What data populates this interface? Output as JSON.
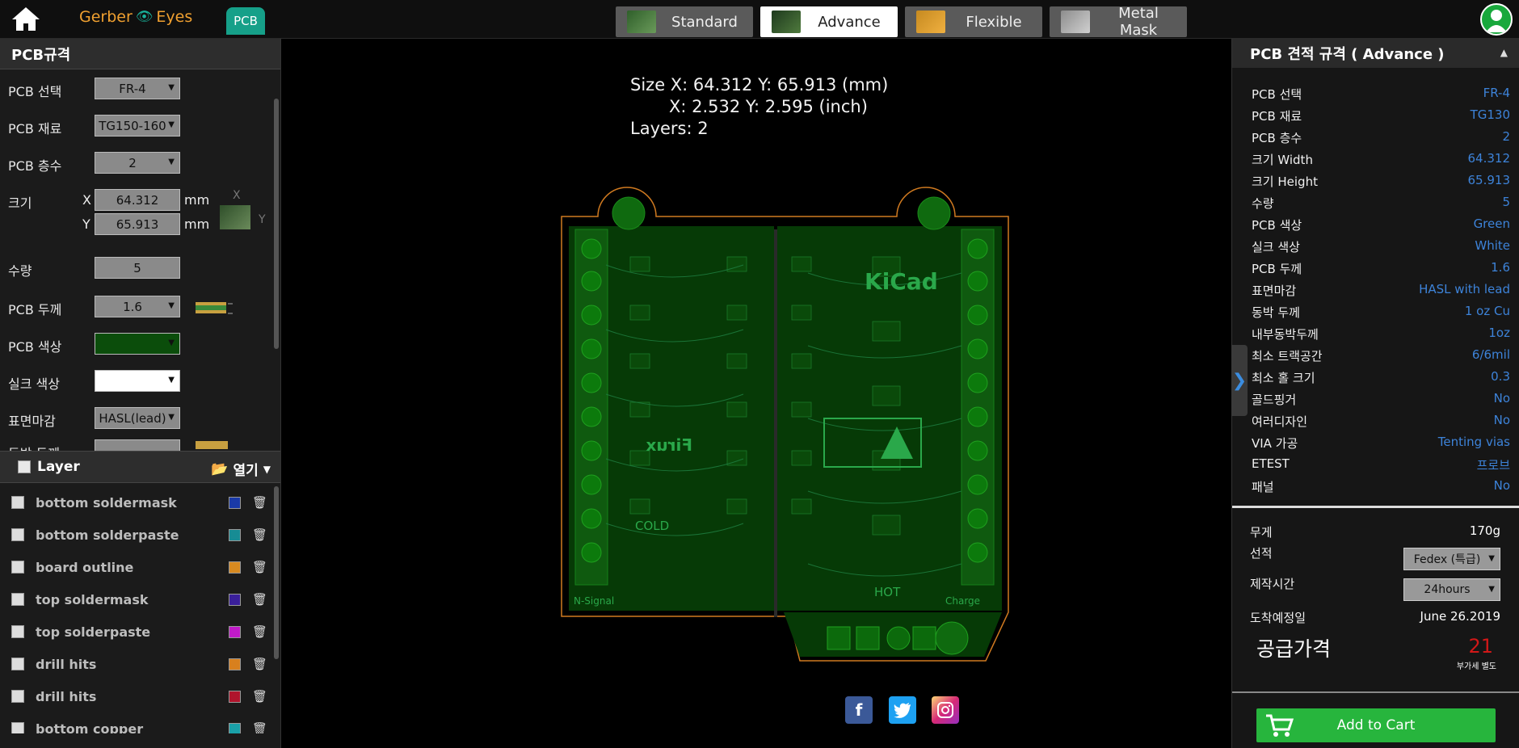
{
  "brand": {
    "gerber": "Gerber",
    "eyes": "Eyes",
    "chip": "PCB"
  },
  "tabs": [
    {
      "label": "Standard",
      "active": false
    },
    {
      "label": "Advance",
      "active": true
    },
    {
      "label": "Flexible",
      "active": false
    },
    {
      "label": "Metal Mask",
      "active": false
    }
  ],
  "left": {
    "title": "PCB규격",
    "pcb_select": {
      "label": "PCB 선택",
      "value": "FR-4"
    },
    "pcb_material": {
      "label": "PCB 재료",
      "value": "TG150-160"
    },
    "pcb_layers": {
      "label": "PCB 층수",
      "value": "2"
    },
    "size": {
      "label": "크기",
      "x_label": "X",
      "y_label": "Y",
      "x": "64.312",
      "y": "65.913",
      "unit": "mm",
      "x_hint": "X",
      "y_hint": "Y"
    },
    "quantity": {
      "label": "수량",
      "value": "5"
    },
    "thickness": {
      "label": "PCB 두께",
      "value": "1.6"
    },
    "pcb_color": {
      "label": "PCB 색상",
      "swatch": "#0b4d0b"
    },
    "silk_color": {
      "label": "실크 색상",
      "swatch": "#ffffff"
    },
    "surface": {
      "label": "표면마감",
      "value": "HASL(lead)"
    },
    "copper": {
      "label": "동박 두께"
    }
  },
  "layers": {
    "title": "Layer",
    "open_label": "열기",
    "items": [
      {
        "name": "bottom soldermask",
        "color": "#1a3aa8"
      },
      {
        "name": "bottom solderpaste",
        "color": "#178c94"
      },
      {
        "name": "board outline",
        "color": "#d88a20"
      },
      {
        "name": "top soldermask",
        "color": "#3a1f9a"
      },
      {
        "name": "top solderpaste",
        "color": "#c01ac8"
      },
      {
        "name": "drill hits",
        "color": "#d8801e"
      },
      {
        "name": "drill hits",
        "color": "#b0142c"
      },
      {
        "name": "bottom copper",
        "color": "#1aa0a8"
      }
    ]
  },
  "center": {
    "size_line1": "Size X: 64.312 Y: 65.913 (mm)",
    "size_line2": "X: 2.532 Y: 2.595 (inch)",
    "layers_line": "Layers: 2"
  },
  "right": {
    "title": "PCB 견적 규격 ( Advance )",
    "specs": [
      {
        "k": "PCB 선택",
        "v": "FR-4"
      },
      {
        "k": "PCB 재료",
        "v": "TG130"
      },
      {
        "k": "PCB 층수",
        "v": "2"
      },
      {
        "k": "크기 Width",
        "v": "64.312"
      },
      {
        "k": "크기 Height",
        "v": "65.913"
      },
      {
        "k": "수량",
        "v": "5"
      },
      {
        "k": "PCB 색상",
        "v": "Green"
      },
      {
        "k": "실크 색상",
        "v": "White"
      },
      {
        "k": "PCB 두께",
        "v": "1.6"
      },
      {
        "k": "표면마감",
        "v": "HASL with lead"
      },
      {
        "k": "동박 두께",
        "v": "1 oz Cu"
      },
      {
        "k": "내부동박두께",
        "v": "1oz"
      },
      {
        "k": "최소 트랙공간",
        "v": "6/6mil"
      },
      {
        "k": "최소 홀 크기",
        "v": "0.3"
      },
      {
        "k": "골드핑거",
        "v": "No"
      },
      {
        "k": "여러디자인",
        "v": "No"
      },
      {
        "k": "VIA 가공",
        "v": "Tenting vias"
      },
      {
        "k": "ETEST",
        "v": "프로브"
      },
      {
        "k": "패널",
        "v": "No"
      }
    ],
    "weight": {
      "label": "무게",
      "value": "170g"
    },
    "shipping": {
      "label": "선적",
      "value": "Fedex (특급)"
    },
    "lead_time": {
      "label": "제작시간",
      "value": "24hours"
    },
    "arrival": {
      "label": "도착예정일",
      "value": "June 26.2019"
    },
    "price": {
      "label": "공급가격",
      "value": "21",
      "note": "부가세 별도"
    },
    "cart_label": "Add to Cart"
  }
}
